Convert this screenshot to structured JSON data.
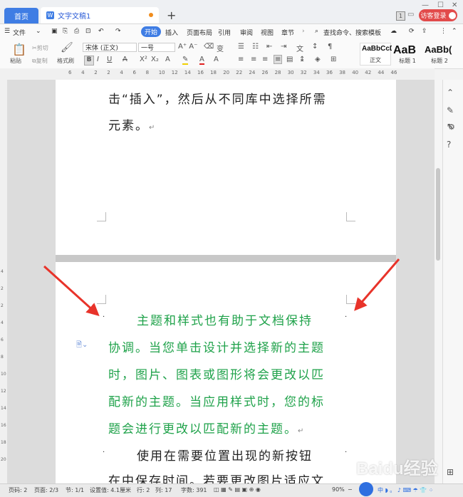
{
  "titlebar": {
    "home_tab": "首页",
    "doc_tab": "文字文稿1",
    "doc_icon": "W",
    "badge": "1",
    "visitor": "访客登录"
  },
  "menu": {
    "file": "文件",
    "items": [
      "开始",
      "插入",
      "页面布局",
      "引用",
      "审阅",
      "视图",
      "章节"
    ],
    "search": "查找命令、搜索模板"
  },
  "ribbon": {
    "paste": "粘贴",
    "cut": "剪切",
    "copy": "复制",
    "format_painter": "格式刷",
    "font_name": "宋体 (正文)",
    "font_size": "一号",
    "styles": [
      {
        "preview": "AaBbCcD",
        "label": "正文"
      },
      {
        "preview": "AaB",
        "label": "标题 1"
      },
      {
        "preview": "AaBb(",
        "label": "标题 2"
      }
    ]
  },
  "ruler": {
    "ticks": [
      "6",
      "4",
      "2",
      "2",
      "4",
      "6",
      "8",
      "10",
      "12",
      "14",
      "16",
      "18",
      "20",
      "22",
      "24",
      "26",
      "28",
      "30",
      "32",
      "34",
      "36",
      "38",
      "40",
      "42",
      "44",
      "46"
    ],
    "vticks": [
      "4",
      "2",
      "2",
      "4",
      "6",
      "8",
      "10",
      "12",
      "14",
      "16",
      "18",
      "20"
    ]
  },
  "document": {
    "page1_lines": [
      "击“插入”，然后从不同库中选择所需",
      "元素。"
    ],
    "page2_green_lines": [
      "主题和样式也有助于文档保持",
      "协调。当您单击设计并选择新的主题",
      "时，图片、图表或图形将会更改以匹",
      "配新的主题。当应用样式时，您的标",
      "题会进行更改以匹配新的主题。"
    ],
    "page2_black_lines": [
      "使用在需要位置出现的新按钮",
      "在中保存时间。若要更改图片适应文"
    ],
    "para_mark": "↵"
  },
  "status": {
    "page_num": "页码: 2",
    "pages": "页面: 2/3",
    "section": "节: 1/1",
    "position": "设置值: 4.1厘米",
    "row": "行: 2",
    "col": "列: 17",
    "words": "字数: 391",
    "zoom": "90%"
  },
  "watermark": "Baidu经验",
  "colors": {
    "accent": "#3f7de4",
    "green_text": "#1fa24a",
    "arrow": "#e8332a",
    "visitor": "#e24b4b"
  }
}
